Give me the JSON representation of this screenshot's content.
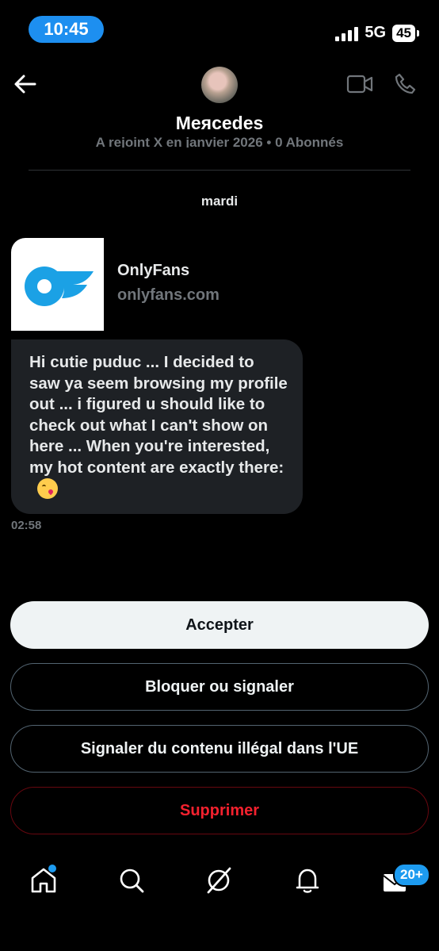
{
  "status_bar": {
    "time": "10:45",
    "network": "5G",
    "battery": "45"
  },
  "header": {
    "name": "Meяcedes",
    "subtitle": "A rejoint X en janvier 2026 • 0 Abonnés"
  },
  "conversation": {
    "day_label": "mardi",
    "link_card": {
      "title": "OnlyFans",
      "domain": "onlyfans.com"
    },
    "message": {
      "text": "Hi cutie puduc ... I decided to saw ya seem browsing my profile out ... i figured u should like to check out what I can't show on here ... When you're interested, my hot content are exactly there:",
      "emoji": "kissing-face-heart"
    },
    "timestamp": "02:58"
  },
  "actions": {
    "accept": "Accepter",
    "block": "Bloquer ou signaler",
    "report": "Signaler du contenu illégal dans l'UE",
    "delete": "Supprimer"
  },
  "tabbar": {
    "messages_badge": "20+"
  },
  "colors": {
    "accent": "#1d9bf0",
    "danger": "#f4212e",
    "bubble": "#1e2125"
  }
}
